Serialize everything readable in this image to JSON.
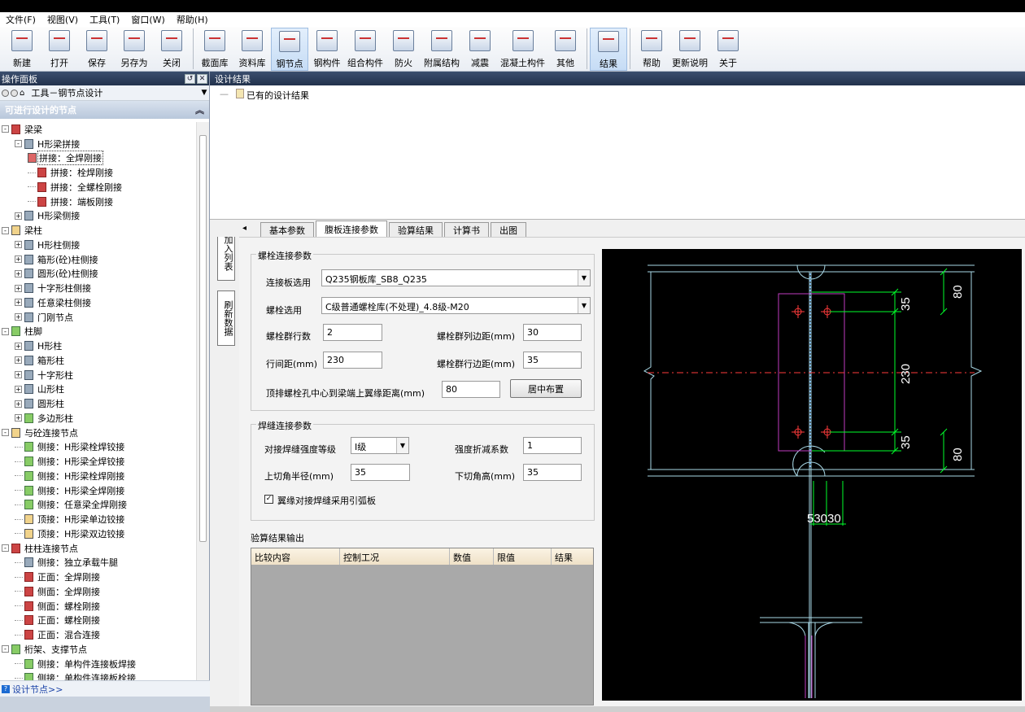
{
  "menu": [
    "文件(F)",
    "视图(V)",
    "工具(T)",
    "窗口(W)",
    "帮助(H)"
  ],
  "toolbar": {
    "group1": [
      {
        "label": "新建",
        "icon": "new-icon"
      },
      {
        "label": "打开",
        "icon": "folder-icon"
      },
      {
        "label": "保存",
        "icon": "save-icon"
      },
      {
        "label": "另存为",
        "icon": "save-as-icon"
      },
      {
        "label": "关闭",
        "icon": "close-file-icon"
      }
    ],
    "group2": [
      {
        "label": "截面库",
        "icon": "section-library-icon"
      },
      {
        "label": "资料库",
        "icon": "data-library-icon"
      },
      {
        "label": "钢节点",
        "icon": "steel-joint-icon",
        "active": true
      },
      {
        "label": "钢构件",
        "icon": "steel-member-icon"
      },
      {
        "label": "组合构件",
        "icon": "composite-member-icon"
      },
      {
        "label": "防火",
        "icon": "fire-protection-icon"
      },
      {
        "label": "附属结构",
        "icon": "auxiliary-structure-icon"
      },
      {
        "label": "减震",
        "icon": "damping-icon"
      },
      {
        "label": "混凝土构件",
        "icon": "concrete-member-icon"
      },
      {
        "label": "其他",
        "icon": "other-icon"
      }
    ],
    "group3": [
      {
        "label": "结果",
        "icon": "result-icon",
        "active": true
      }
    ],
    "group4": [
      {
        "label": "帮助",
        "icon": "help-icon"
      },
      {
        "label": "更新说明",
        "icon": "update-info-icon"
      },
      {
        "label": "关于",
        "icon": "about-icon"
      }
    ]
  },
  "left_panel": {
    "title": "操作面板",
    "tool_combo": "工具－钢节点设计",
    "section_title": "可进行设计的节点",
    "footer_link": "设计节点>>",
    "tree": [
      {
        "label": "梁梁",
        "level": 0,
        "pm": "-",
        "icon": "r"
      },
      {
        "label": "H形梁拼接",
        "level": 1,
        "pm": "-",
        "icon": "b"
      },
      {
        "label": "拼接：全焊刚接",
        "level": 2,
        "icon": "sel"
      },
      {
        "label": "拼接：栓焊刚接",
        "level": 2,
        "icon": "r"
      },
      {
        "label": "拼接：全螺栓刚接",
        "level": 2,
        "icon": "r"
      },
      {
        "label": "拼接：端板刚接",
        "level": 2,
        "icon": "r"
      },
      {
        "label": "H形梁侧接",
        "level": 1,
        "pm": "+",
        "icon": "b"
      },
      {
        "label": "梁柱",
        "level": 0,
        "pm": "-",
        "icon": ""
      },
      {
        "label": "H形柱侧接",
        "level": 1,
        "pm": "+",
        "icon": "b"
      },
      {
        "label": "箱形(砼)柱侧接",
        "level": 1,
        "pm": "+",
        "icon": "b"
      },
      {
        "label": "圆形(砼)柱侧接",
        "level": 1,
        "pm": "+",
        "icon": "b"
      },
      {
        "label": "十字形柱侧接",
        "level": 1,
        "pm": "+",
        "icon": "b"
      },
      {
        "label": "任意梁柱侧接",
        "level": 1,
        "pm": "+",
        "icon": "b"
      },
      {
        "label": "门刚节点",
        "level": 1,
        "pm": "+",
        "icon": "b"
      },
      {
        "label": "柱脚",
        "level": 0,
        "pm": "-",
        "icon": "g"
      },
      {
        "label": "H形柱",
        "level": 1,
        "pm": "+",
        "icon": "b"
      },
      {
        "label": "箱形柱",
        "level": 1,
        "pm": "+",
        "icon": "b"
      },
      {
        "label": "十字形柱",
        "level": 1,
        "pm": "+",
        "icon": "b"
      },
      {
        "label": "山形柱",
        "level": 1,
        "pm": "+",
        "icon": "b"
      },
      {
        "label": "圆形柱",
        "level": 1,
        "pm": "+",
        "icon": "b"
      },
      {
        "label": "多边形柱",
        "level": 1,
        "pm": "+",
        "icon": "g"
      },
      {
        "label": "与砼连接节点",
        "level": 0,
        "pm": "-",
        "icon": ""
      },
      {
        "label": "侧接：H形梁栓焊铰接",
        "level": 1,
        "icon": "g"
      },
      {
        "label": "侧接：H形梁全焊铰接",
        "level": 1,
        "icon": "g"
      },
      {
        "label": "侧接：H形梁栓焊刚接",
        "level": 1,
        "icon": "g"
      },
      {
        "label": "侧接：H形梁全焊刚接",
        "level": 1,
        "icon": "g"
      },
      {
        "label": "侧接：任意梁全焊刚接",
        "level": 1,
        "icon": "g"
      },
      {
        "label": "顶接：H形梁单边铰接",
        "level": 1,
        "icon": ""
      },
      {
        "label": "顶接：H形梁双边铰接",
        "level": 1,
        "icon": ""
      },
      {
        "label": "柱柱连接节点",
        "level": 0,
        "pm": "-",
        "icon": "r"
      },
      {
        "label": "侧接：独立承载牛腿",
        "level": 1,
        "icon": "b"
      },
      {
        "label": "正面：全焊刚接",
        "level": 1,
        "icon": "r"
      },
      {
        "label": "侧面：全焊刚接",
        "level": 1,
        "icon": "r"
      },
      {
        "label": "侧面：螺栓刚接",
        "level": 1,
        "icon": "r"
      },
      {
        "label": "正面：螺栓刚接",
        "level": 1,
        "icon": "r"
      },
      {
        "label": "正面：混合连接",
        "level": 1,
        "icon": "r"
      },
      {
        "label": "桁架、支撑节点",
        "level": 0,
        "pm": "-",
        "icon": "g"
      },
      {
        "label": "侧接：单构件连接板焊接",
        "level": 1,
        "icon": "g"
      },
      {
        "label": "侧接：单构件连接板栓接",
        "level": 1,
        "icon": "g"
      }
    ]
  },
  "right_panel": {
    "title": "设计结果",
    "results_item": "已有的设计结果",
    "vertical_buttons": [
      "加入列表",
      "刷新数据"
    ],
    "tabs": [
      "基本参数",
      "腹板连接参数",
      "验算结果",
      "计算书",
      "出图"
    ],
    "active_tab": 1,
    "bolt_group": {
      "title": "螺栓连接参数",
      "plate_label": "连接板选用",
      "plate_value": "Q235钢板库_SB8_Q235",
      "bolt_label": "螺栓选用",
      "bolt_value": "C级普通螺栓库(不处理)_4.8级-M20",
      "rows_label": "螺栓群行数",
      "rows_value": "2",
      "col_edge_label": "螺栓群列边距(mm)",
      "col_edge_value": "30",
      "row_spacing_label": "行间距(mm)",
      "row_spacing_value": "230",
      "row_edge_label": "螺栓群行边距(mm)",
      "row_edge_value": "35",
      "top_dist_label": "顶排螺栓孔中心到梁端上翼缘距离(mm)",
      "top_dist_value": "80",
      "center_button": "居中布置"
    },
    "weld_group": {
      "title": "焊缝连接参数",
      "grade_label": "对接焊缝强度等级",
      "grade_value": "Ⅰ级",
      "reduction_label": "强度折减系数",
      "reduction_value": "1",
      "upper_radius_label": "上切角半径(mm)",
      "upper_radius_value": "35",
      "lower_height_label": "下切角高(mm)",
      "lower_height_value": "35",
      "checkbox_label": "翼缘对接焊缝采用引弧板",
      "checkbox_checked": true
    },
    "output": {
      "title": "验算结果输出",
      "columns": [
        "比较内容",
        "控制工况",
        "数值",
        "限值",
        "结果"
      ]
    },
    "drawing": {
      "dims_right_outer": [
        "80",
        "80"
      ],
      "dims_right_inner": [
        "35",
        "230",
        "35"
      ],
      "dims_bottom": "53030",
      "colors": {
        "dimension": "#00ff2a",
        "plate": "#c13bc1",
        "beam": "#a9d8e6",
        "center_line": "#ff3b3b",
        "background": "#000000"
      }
    }
  }
}
